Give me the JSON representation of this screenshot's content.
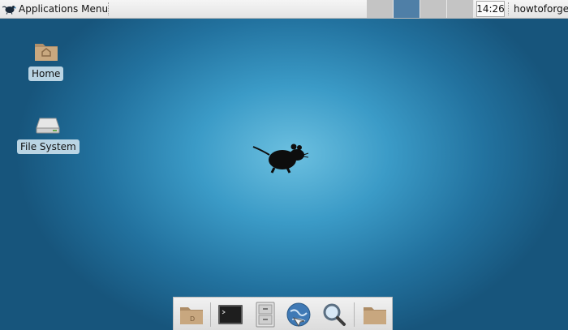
{
  "top_panel": {
    "applications_menu_label": "Applications Menu",
    "clock": "14:26",
    "user": "howtoforge",
    "workspaces": [
      {
        "active": false
      },
      {
        "active": true
      },
      {
        "active": false
      },
      {
        "active": false
      }
    ]
  },
  "desktop": {
    "icons": [
      {
        "label": "Home",
        "icon": "home-folder-icon"
      },
      {
        "label": "File System",
        "icon": "drive-icon"
      }
    ]
  },
  "dock": {
    "launchers": [
      {
        "icon": "folder-icon"
      },
      {
        "icon": "terminal-icon"
      },
      {
        "icon": "file-manager-icon"
      },
      {
        "icon": "web-browser-icon"
      },
      {
        "icon": "search-icon"
      },
      {
        "icon": "folder-icon"
      }
    ]
  },
  "colors": {
    "wallpaper_center": "#6cc0e0",
    "wallpaper_edge": "#17557c",
    "active_workspace": "#4f7fa7"
  }
}
